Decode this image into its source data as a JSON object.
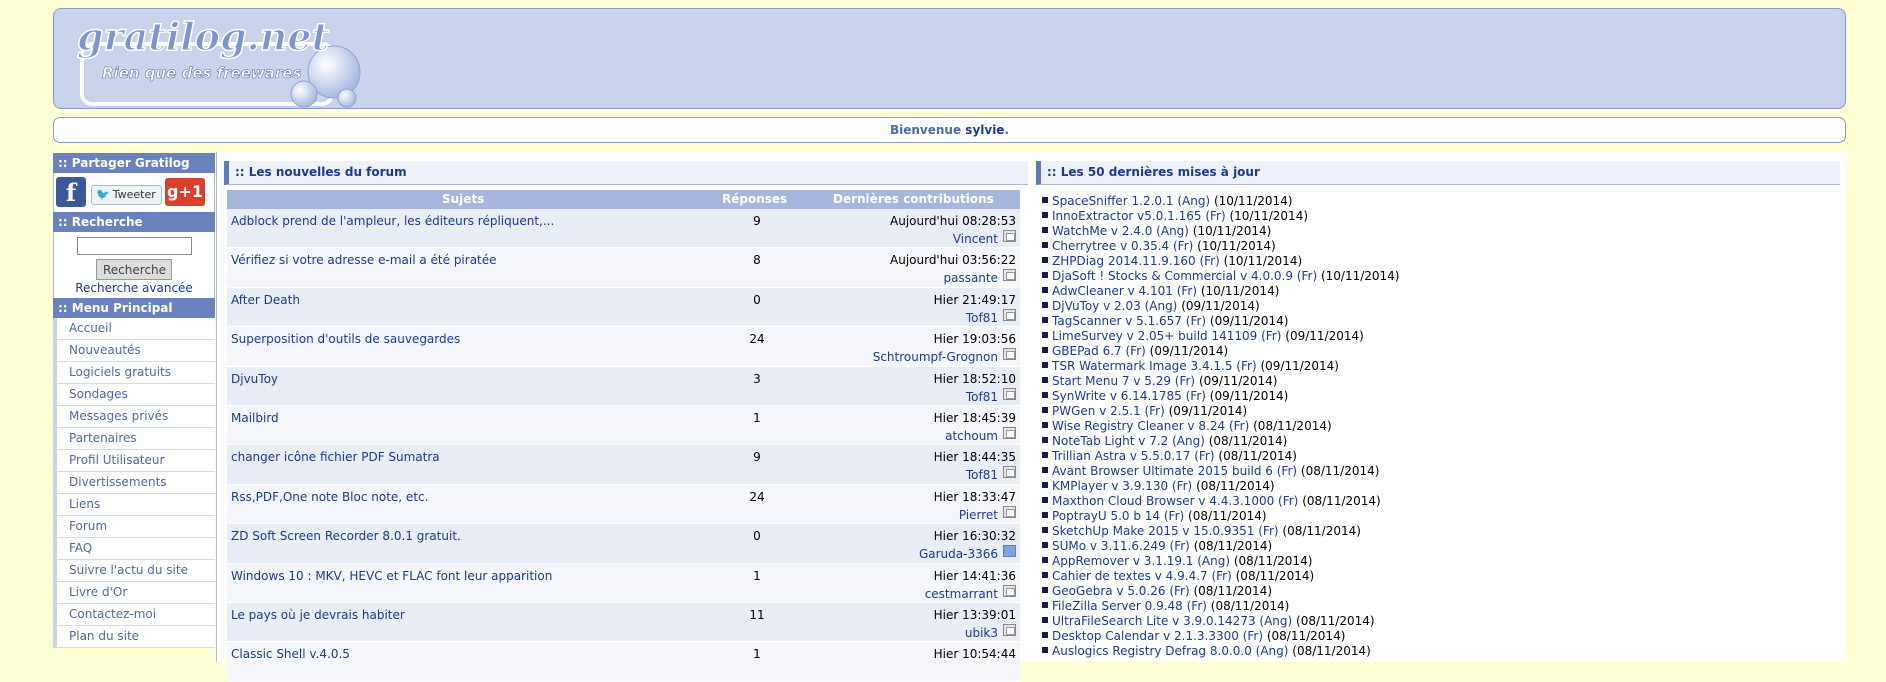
{
  "header": {
    "logo_title": "gratilog.net",
    "logo_tagline": "Rien que des freewares"
  },
  "welcome": {
    "prefix": "Bienvenue",
    "user": "sylvie",
    "suffix": "."
  },
  "sidebar": {
    "share_title": ":: Partager Gratilog",
    "facebook_glyph": "f",
    "tweet_label": "Tweeter",
    "gplus_label": "g+1",
    "search_title": ":: Recherche",
    "search_value": "",
    "search_button": "Recherche",
    "advanced_search": "Recherche avancée",
    "menu_title": ":: Menu Principal",
    "menu": [
      "Accueil",
      "Nouveautés",
      "Logiciels gratuits",
      "Sondages",
      "Messages privés",
      "Partenaires",
      "Profil Utilisateur",
      "Divertissements",
      "Liens",
      "Forum",
      "FAQ",
      "Suivre l'actu du site",
      "Livre d'Or",
      "Contactez-moi",
      "Plan du site"
    ]
  },
  "forum": {
    "title": ":: Les nouvelles du forum",
    "columns": {
      "subject": "Sujets",
      "replies": "Réponses",
      "latest": "Dernières contributions"
    },
    "rows": [
      {
        "subject": "Adblock prend de l'ampleur, les éditeurs répliquent,...",
        "replies": "9",
        "date": "Aujourd'hui 08:28:53",
        "user": "Vincent"
      },
      {
        "subject": "Vérifiez si votre adresse e-mail a été piratée",
        "replies": "8",
        "date": "Aujourd'hui 03:56:22",
        "user": "passante"
      },
      {
        "subject": "After Death",
        "replies": "0",
        "date": "Hier 21:49:17",
        "user": "Tof81"
      },
      {
        "subject": "Superposition d'outils de sauvegardes",
        "replies": "24",
        "date": "Hier 19:03:56",
        "user": "Schtroumpf-Grognon"
      },
      {
        "subject": "DjvuToy",
        "replies": "3",
        "date": "Hier 18:52:10",
        "user": "Tof81"
      },
      {
        "subject": "Mailbird",
        "replies": "1",
        "date": "Hier 18:45:39",
        "user": "atchoum"
      },
      {
        "subject": "changer icône fichier PDF Sumatra",
        "replies": "9",
        "date": "Hier 18:44:35",
        "user": "Tof81"
      },
      {
        "subject": "Rss,PDF,One note Bloc note, etc.",
        "replies": "24",
        "date": "Hier 18:33:47",
        "user": "Pierret"
      },
      {
        "subject": "ZD Soft Screen Recorder 8.0.1 gratuit.",
        "replies": "0",
        "date": "Hier 16:30:32",
        "user": "Garuda-3366",
        "icon": "smile"
      },
      {
        "subject": "Windows 10 : MKV, HEVC et FLAC font leur apparition",
        "replies": "1",
        "date": "Hier 14:41:36",
        "user": "cestmarrant"
      },
      {
        "subject": "Le pays où je devrais habiter",
        "replies": "11",
        "date": "Hier 13:39:01",
        "user": "ubik3"
      },
      {
        "subject": "Classic Shell v.4.0.5",
        "replies": "1",
        "date": "Hier 10:54:44",
        "user": ""
      }
    ]
  },
  "updates": {
    "title": ":: Les 50 dernières mises à jour",
    "items": [
      {
        "name": "SpaceSniffer 1.2.0.1 (Ang)",
        "date": "(10/11/2014)"
      },
      {
        "name": "InnoExtractor v5.0.1.165 (Fr)",
        "date": "(10/11/2014)"
      },
      {
        "name": "WatchMe v 2.4.0 (Ang)",
        "date": "(10/11/2014)"
      },
      {
        "name": "Cherrytree v 0.35.4 (Fr)",
        "date": "(10/11/2014)"
      },
      {
        "name": "ZHPDiag 2014.11.9.160 (Fr)",
        "date": "(10/11/2014)"
      },
      {
        "name": "DjaSoft ! Stocks & Commercial v 4.0.0.9 (Fr)",
        "date": "(10/11/2014)"
      },
      {
        "name": "AdwCleaner v 4.101 (Fr)",
        "date": "(10/11/2014)"
      },
      {
        "name": "DjVuToy v 2.03 (Ang)",
        "date": "(09/11/2014)"
      },
      {
        "name": "TagScanner v 5.1.657 (Fr)",
        "date": "(09/11/2014)"
      },
      {
        "name": "LimeSurvey v 2.05+ build 141109 (Fr)",
        "date": "(09/11/2014)"
      },
      {
        "name": "GBEPad 6.7 (Fr)",
        "date": "(09/11/2014)"
      },
      {
        "name": "TSR Watermark Image 3.4.1.5 (Fr)",
        "date": "(09/11/2014)"
      },
      {
        "name": "Start Menu 7 v 5.29 (Fr)",
        "date": "(09/11/2014)"
      },
      {
        "name": "SynWrite v 6.14.1785 (Fr)",
        "date": "(09/11/2014)"
      },
      {
        "name": "PWGen v 2.5.1 (Fr)",
        "date": "(09/11/2014)"
      },
      {
        "name": "Wise Registry Cleaner v 8.24 (Fr)",
        "date": "(08/11/2014)"
      },
      {
        "name": "NoteTab Light v 7.2 (Ang)",
        "date": "(08/11/2014)"
      },
      {
        "name": "Trillian Astra v 5.5.0.17 (Fr)",
        "date": "(08/11/2014)"
      },
      {
        "name": "Avant Browser Ultimate 2015 build 6 (Fr)",
        "date": "(08/11/2014)"
      },
      {
        "name": "KMPlayer v 3.9.130 (Fr)",
        "date": "(08/11/2014)"
      },
      {
        "name": "Maxthon Cloud Browser v 4.4.3.1000 (Fr)",
        "date": "(08/11/2014)"
      },
      {
        "name": "PoptrayU 5.0 b 14 (Fr)",
        "date": "(08/11/2014)"
      },
      {
        "name": "SketchUp Make 2015 v 15.0.9351 (Fr)",
        "date": "(08/11/2014)"
      },
      {
        "name": "SUMo v 3.11.6.249 (Fr)",
        "date": "(08/11/2014)"
      },
      {
        "name": "AppRemover v 3.1.19.1 (Ang)",
        "date": "(08/11/2014)"
      },
      {
        "name": "Cahier de textes v 4.9.4.7 (Fr)",
        "date": "(08/11/2014)"
      },
      {
        "name": "GeoGebra v 5.0.26 (Fr)",
        "date": "(08/11/2014)"
      },
      {
        "name": "FileZilla Server 0.9.48 (Fr)",
        "date": "(08/11/2014)"
      },
      {
        "name": "UltraFileSearch Lite v 3.9.0.14273 (Ang)",
        "date": "(08/11/2014)"
      },
      {
        "name": "Desktop Calendar v 2.1.3.3300 (Fr)",
        "date": "(08/11/2014)"
      },
      {
        "name": "Auslogics Registry Defrag 8.0.0.0 (Ang)",
        "date": "(08/11/2014)"
      }
    ]
  },
  "colors": {
    "page_background": "#ffffd6",
    "header_background": "#c9d3ec",
    "sidebar_header": "#6a83bf",
    "link": "#1a3a94"
  }
}
